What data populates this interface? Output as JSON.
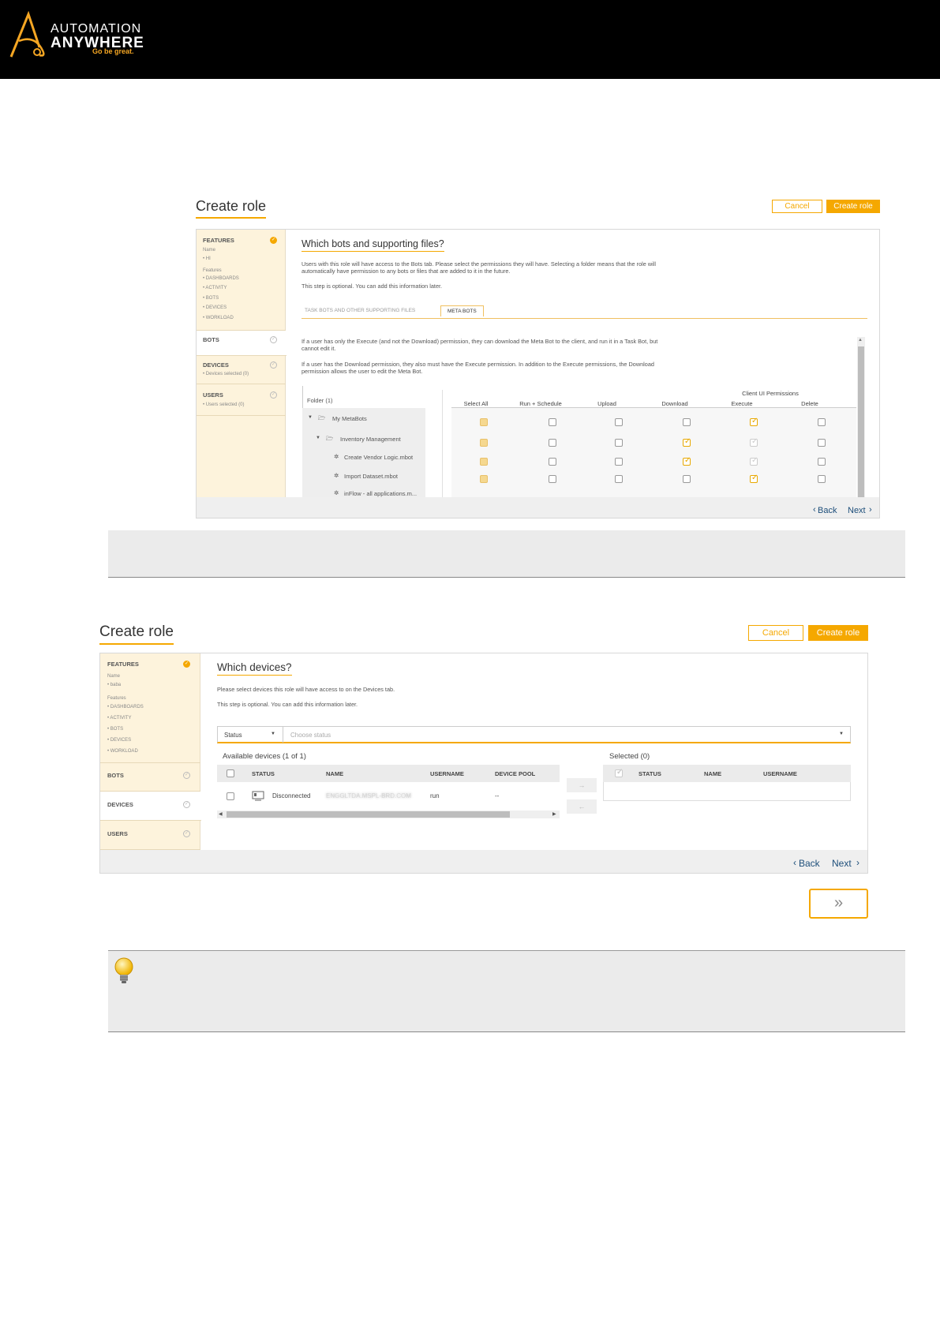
{
  "brand": {
    "line1": "AUTOMATION",
    "line2": "ANYWHERE",
    "tagline": "Go be great."
  },
  "colors": {
    "accent": "#f5a800",
    "sidebar_bg": "#fdf3dc",
    "link": "#1d4e7a"
  },
  "shot1": {
    "title": "Create role",
    "cancel": "Cancel",
    "create": "Create role",
    "sidebar": {
      "features": "FEATURES",
      "name_label": "Name",
      "name_value": "• HI",
      "features_label": "Features",
      "features_items": [
        "• DASHBOARDS",
        "• ACTIVITY",
        "• BOTS",
        "• DEVICES",
        "• WORKLOAD"
      ],
      "bots": "BOTS",
      "devices": "DEVICES",
      "devices_sub": "• Devices selected (0)",
      "users": "USERS",
      "users_sub": "• Users selected (0)"
    },
    "heading": "Which bots and supporting files?",
    "intro1": "Users with this role will have access to the Bots tab. Please select the permissions they will have. Selecting a folder means that the role will",
    "intro2": "automatically have permission to any bots or files that are added to it in the future.",
    "optional": "This step is optional. You can add this information later.",
    "tab1": "TASK BOTS AND OTHER SUPPORTING FILES",
    "tab2": "META BOTS",
    "info1a": "If a user has only the Execute (and not the Download) permission, they can download the Meta Bot to the client, and run it in a Task Bot, but",
    "info1b": "cannot edit it.",
    "info2a": "If a user has the Download permission, they also must have the Execute permission. In addition to the Execute permissions, the Download",
    "info2b": "permission allows the user to edit the Meta Bot.",
    "folder_header": "Folder (1)",
    "client_ui": "Client UI Permissions",
    "columns": [
      "Select All",
      "Run + Schedule",
      "Upload",
      "Download",
      "Execute",
      "Delete"
    ],
    "tree": [
      "My MetaBots",
      "Inventory Management",
      "Create Vendor Logic.mbot",
      "Import Dataset.mbot",
      "inFlow - all applications.m..."
    ],
    "back": "Back",
    "next": "Next"
  },
  "shot2": {
    "title": "Create role",
    "cancel": "Cancel",
    "create": "Create role",
    "sidebar": {
      "features": "FEATURES",
      "name_label": "Name",
      "name_value": "• baba",
      "features_label": "Features",
      "features_items": [
        "• DASHBOARDS",
        "• ACTIVITY",
        "• BOTS",
        "• DEVICES",
        "• WORKLOAD"
      ],
      "bots": "BOTS",
      "devices": "DEVICES",
      "users": "USERS"
    },
    "heading": "Which devices?",
    "intro": "Please select devices this role will have access to on the Devices tab.",
    "optional": "This step is optional. You can add this information later.",
    "filter_field": "Status",
    "filter_placeholder": "Choose status",
    "available": "Available devices (1 of 1)",
    "selected": "Selected (0)",
    "avail_cols": [
      "STATUS",
      "NAME",
      "USERNAME",
      "DEVICE POOL"
    ],
    "sel_cols": [
      "STATUS",
      "NAME",
      "USERNAME"
    ],
    "row": {
      "status": "Disconnected",
      "name": "ENGGLTDA.MSPL-BRD.COM",
      "username": "run",
      "pool": "--"
    },
    "move_right": "→",
    "move_left": "←",
    "back": "Back",
    "next": "Next"
  },
  "forward_button": "»"
}
